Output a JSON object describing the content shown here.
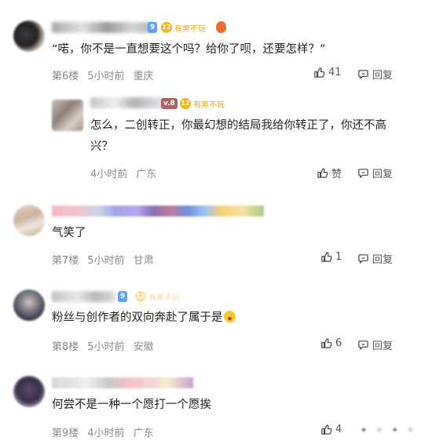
{
  "comments": [
    {
      "text": "“喏，你不是一直想要这个吗？给你了呗，还要怎样？”",
      "floor": "第6楼",
      "time": "5小时前",
      "location": "重庆",
      "likes": "41",
      "reply": "回复",
      "badge": "有男不玩",
      "badge_level": "12",
      "user_level": "9"
    },
    {
      "text_line1": "怎么，二创转正，你最幻想的结局我给你转正了，你还不高",
      "text_line2": "兴？",
      "time": "4小时前",
      "location": "广东",
      "likes": "赞",
      "reply": "回复",
      "badge": "有男不玩",
      "badge_level": "12",
      "user_level": "v.8"
    },
    {
      "text": "气笑了",
      "floor": "第7楼",
      "time": "5小时前",
      "location": "甘肃",
      "likes": "1",
      "reply": "回复"
    },
    {
      "text": "粉丝与创作者的双向奔赴了属于是",
      "floor": "第8楼",
      "time": "5小时前",
      "location": "安徽",
      "likes": "6",
      "reply": "回复"
    },
    {
      "text": "何尝不是一种一个愿打一个愿挨",
      "floor": "第9楼",
      "time": "4小时前",
      "location": "广东",
      "likes": "4"
    }
  ],
  "colors": {
    "badge_gold": "#f6b21f",
    "meta_gray": "#8a8a8a",
    "level_blue": "#5aa0ff"
  }
}
